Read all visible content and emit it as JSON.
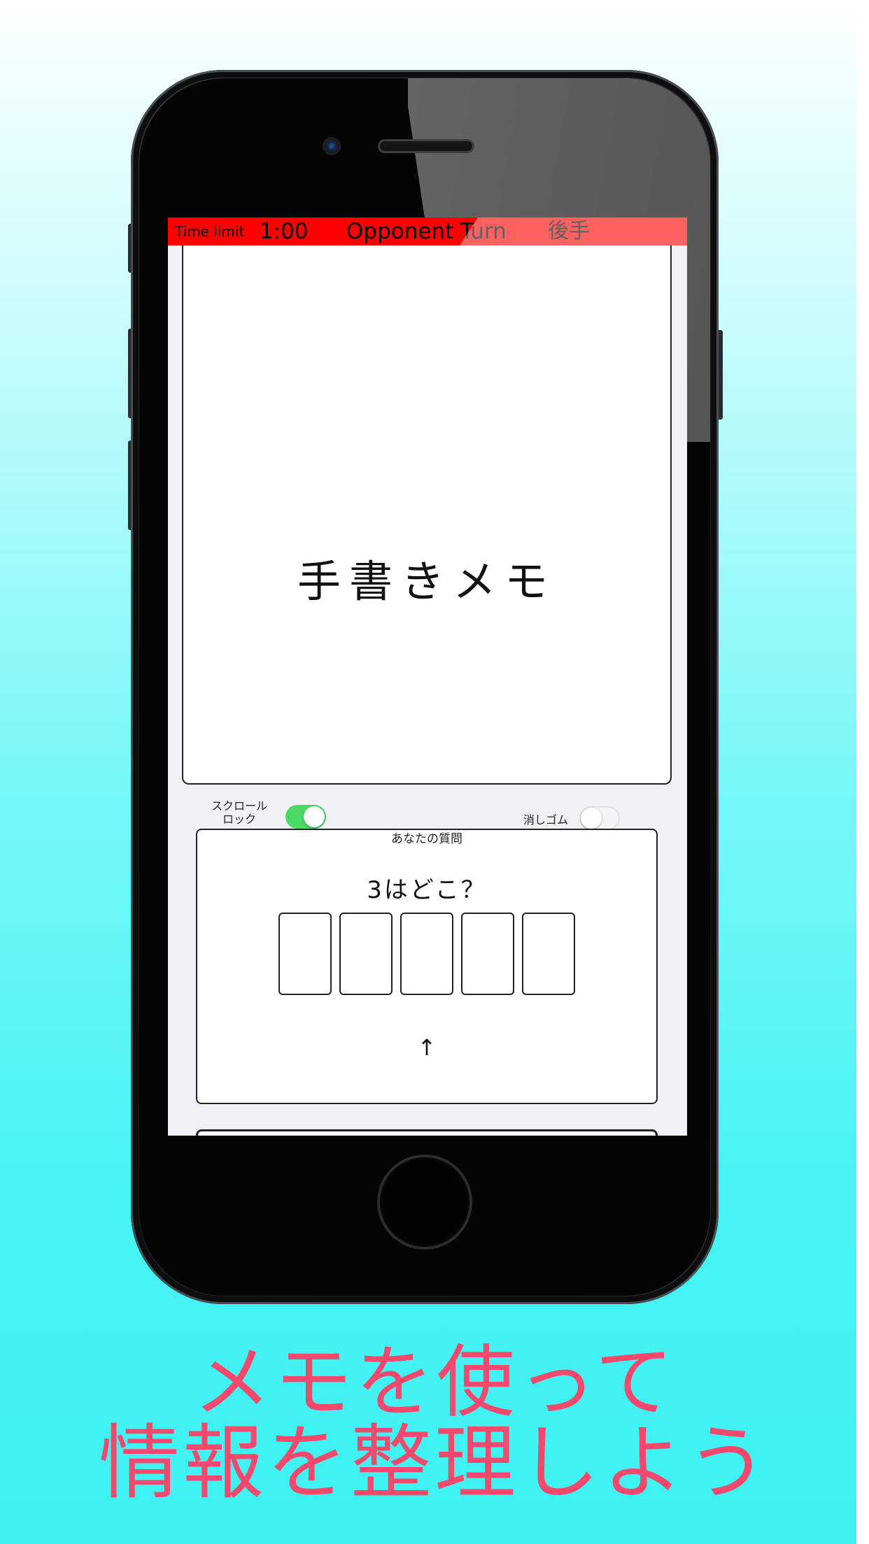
{
  "status_bar": {
    "time_limit_label": "Time limit",
    "time": "1:00",
    "turn": "Opponent Turn",
    "order": "後手",
    "color": "#ff0000"
  },
  "memo": {
    "placeholder_text": "手書きメモ"
  },
  "controls": {
    "scroll_lock_label_line1": "スクロール",
    "scroll_lock_label_line2": "ロック",
    "scroll_lock_on": true,
    "eraser_label": "消しゴム",
    "eraser_on": false
  },
  "question": {
    "header": "あなたの質問",
    "text": "3はどこ？",
    "card_count": 5,
    "pointer": "↑"
  },
  "caption": {
    "line1": "メモを使って",
    "line2": "情報を整理しよう",
    "color": "#f4486c"
  }
}
